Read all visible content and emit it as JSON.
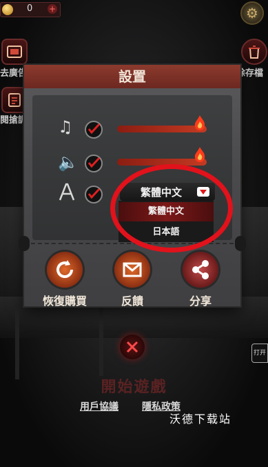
{
  "top": {
    "coins": "0",
    "plus": "+"
  },
  "side": {
    "left_top_label": "去廣告",
    "left_bottom_label": "閱搶調",
    "right_top_label": "除存檔",
    "open_label": "打开"
  },
  "dialog": {
    "title": "設置",
    "music_enabled": true,
    "sound_enabled": true,
    "music_level": 0.92,
    "sound_level": 0.92,
    "language": {
      "selected": "繁體中文",
      "options": [
        "繁體中文",
        "日本語"
      ]
    },
    "actions": {
      "restore": "恢復購買",
      "feedback": "反饋",
      "share": "分享"
    }
  },
  "bottom": {
    "start": "開始遊戲",
    "user_agreement": "用戶協議",
    "privacy": "隱私政策"
  },
  "watermark": "沃德下载站",
  "colors": {
    "accent": "#e1121b",
    "title_bar": "#8c3a2d"
  }
}
